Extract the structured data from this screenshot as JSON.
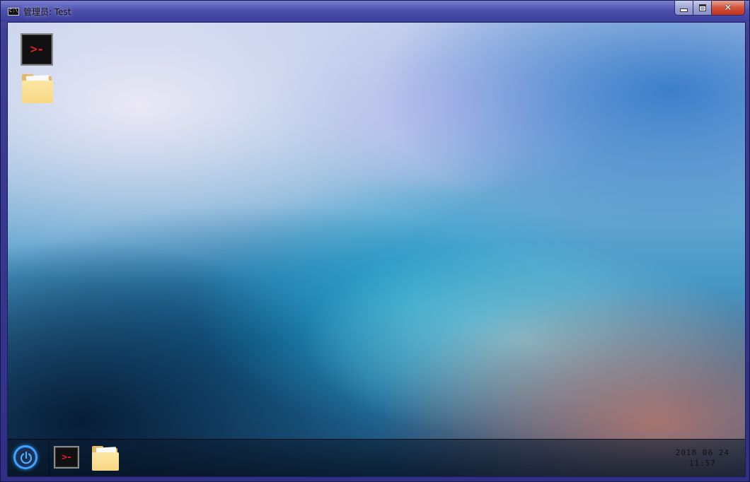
{
  "window": {
    "title": "管理员: Test",
    "title_icon": "console-icon",
    "title_icon_text": "C:\\",
    "controls": {
      "minimize_icon": "minimize-icon",
      "maximize_icon": "maximize-icon",
      "close_icon": "close-icon",
      "close_glyph": "✕"
    }
  },
  "desktop": {
    "icons": [
      {
        "name": "terminal",
        "icon": "terminal-icon",
        "glyph": ">-"
      },
      {
        "name": "folder",
        "icon": "folder-icon"
      }
    ]
  },
  "taskbar": {
    "power_icon": "power-icon",
    "pinned": [
      {
        "name": "terminal",
        "icon": "terminal-icon",
        "glyph": ">-"
      },
      {
        "name": "folder",
        "icon": "folder-icon"
      }
    ],
    "clock": {
      "date": "2018 06 24",
      "time": "11:57"
    }
  },
  "colors": {
    "accent_power": "#3fa2ff",
    "terminal_glyph": "#e0202a",
    "window_frame": "#3e3f96",
    "close_button": "#c0301a"
  }
}
